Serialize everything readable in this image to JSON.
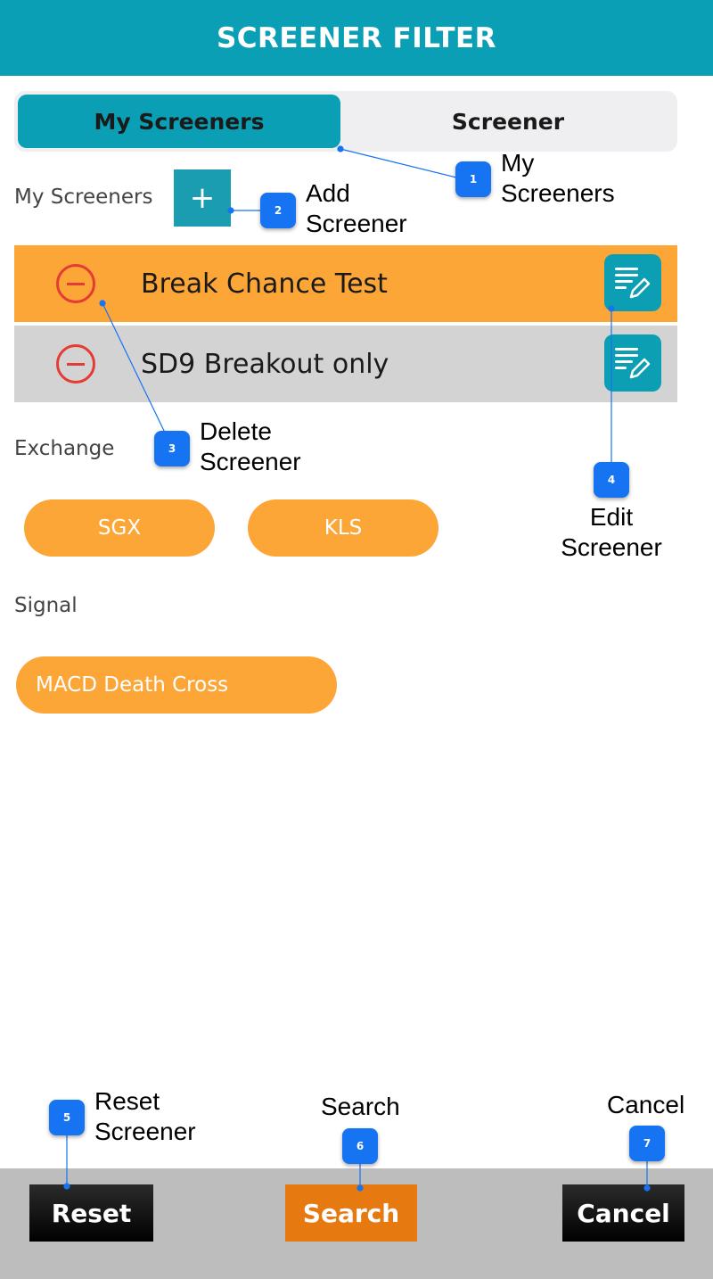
{
  "header": {
    "title": "SCREENER FILTER"
  },
  "segmented": {
    "my_screeners": "My Screeners",
    "screener": "Screener"
  },
  "section": {
    "my_screeners_label": "My Screeners",
    "add_glyph": "+",
    "exchange_label": "Exchange",
    "signal_label": "Signal"
  },
  "screeners": [
    {
      "name": "Break Chance Test",
      "highlight": "#fca637"
    },
    {
      "name": "SD9 Breakout only",
      "highlight": "#d3d3d3"
    }
  ],
  "exchanges": [
    "SGX",
    "KLS"
  ],
  "signals": [
    "MACD Death Cross"
  ],
  "footer": {
    "reset": "Reset",
    "search": "Search",
    "cancel": "Cancel"
  },
  "annotations": [
    {
      "num": "1",
      "text_line1": "My",
      "text_line2": "Screeners"
    },
    {
      "num": "2",
      "text_line1": "Add",
      "text_line2": "Screener"
    },
    {
      "num": "3",
      "text_line1": "Delete",
      "text_line2": "Screener"
    },
    {
      "num": "4",
      "text_line1": "Edit",
      "text_line2": "Screener"
    },
    {
      "num": "5",
      "text_line1": "Reset",
      "text_line2": "Screener"
    },
    {
      "num": "6",
      "text_line1": "Search",
      "text_line2": ""
    },
    {
      "num": "7",
      "text_line1": "Cancel",
      "text_line2": ""
    }
  ],
  "colors": {
    "teal": "#0a9fb4",
    "orange": "#fca637",
    "delete_red": "#e53b35",
    "badge_blue": "#1673f2",
    "search_orange": "#e6790f"
  },
  "icons": {
    "add": "plus-icon",
    "delete": "minus-circle-icon",
    "edit": "edit-list-pencil-icon"
  }
}
